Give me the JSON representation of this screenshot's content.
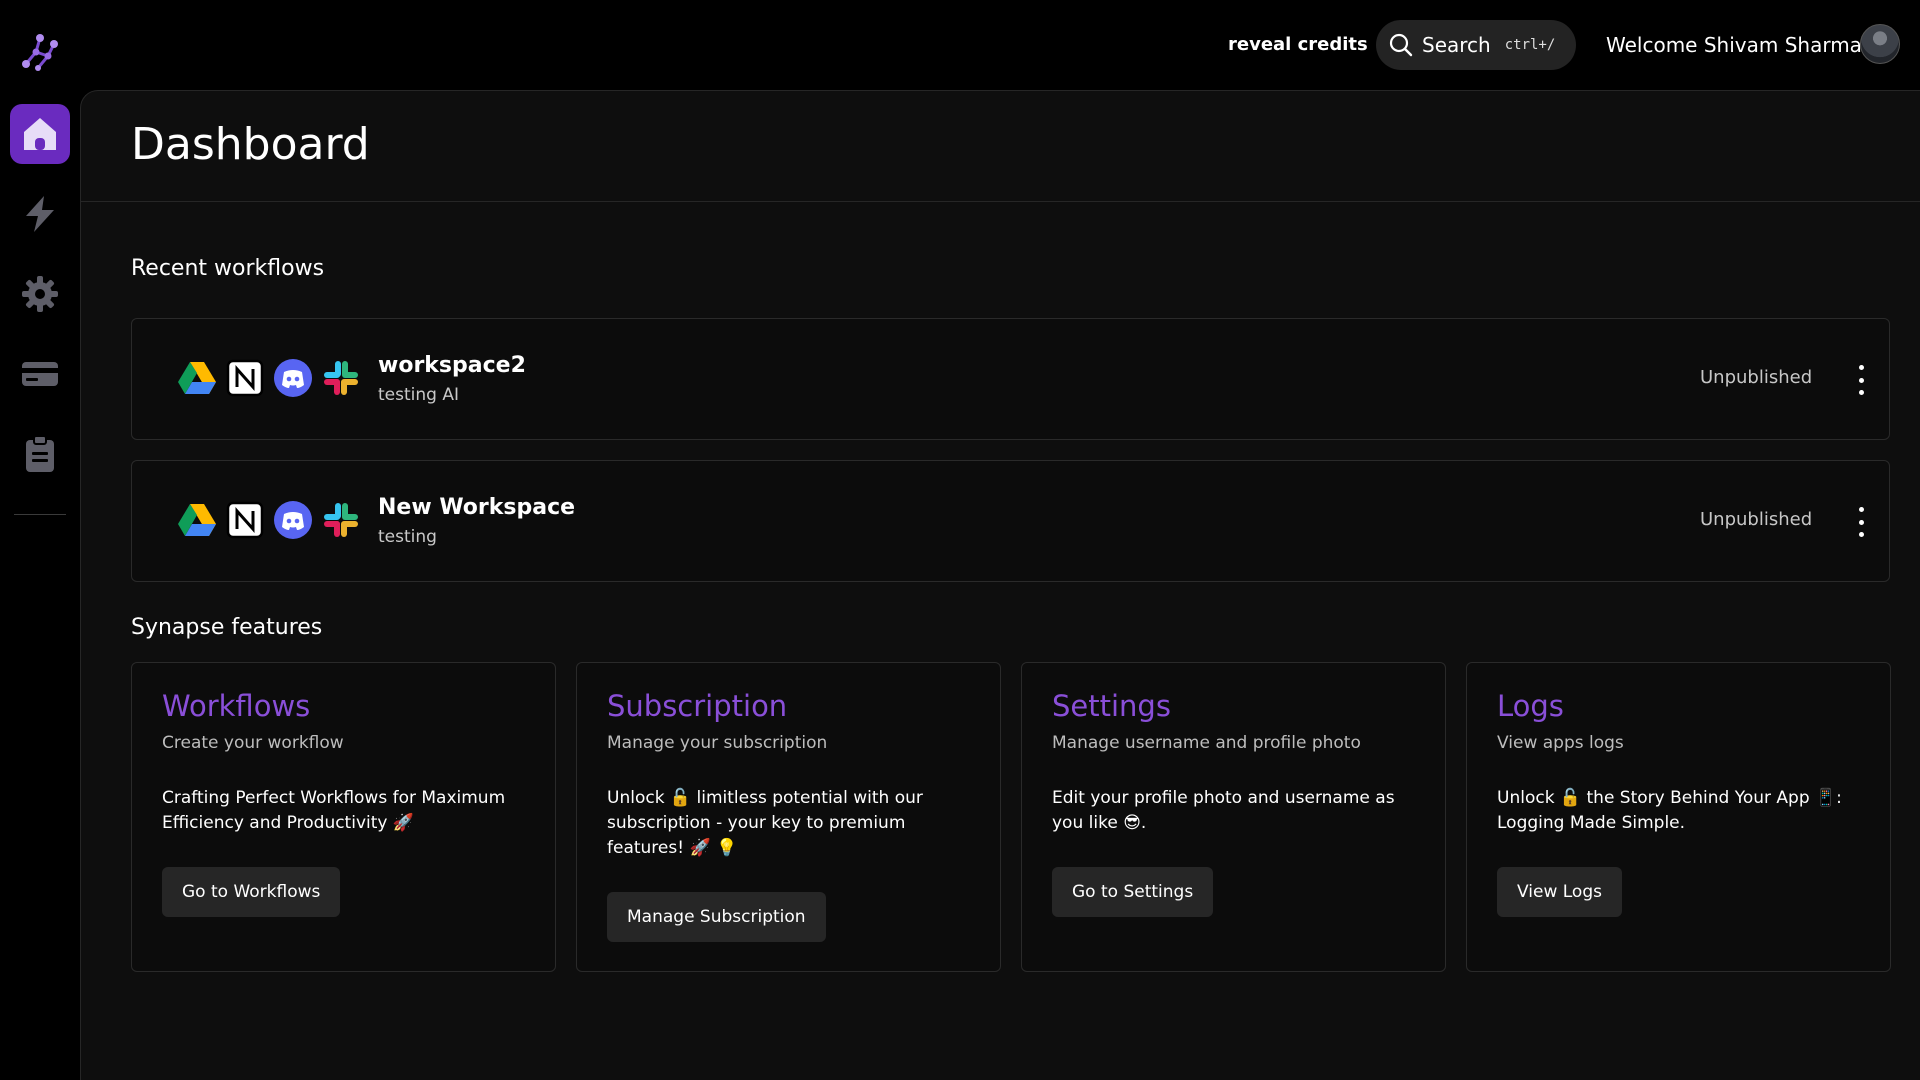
{
  "header": {
    "reveal_credits": "reveal credits",
    "search_label": "Search",
    "search_shortcut": "ctrl+/",
    "welcome": "Welcome Shivam Sharma"
  },
  "sidebar": {
    "items": [
      {
        "name": "home",
        "active": true
      },
      {
        "name": "workflows"
      },
      {
        "name": "settings"
      },
      {
        "name": "subscription"
      },
      {
        "name": "logs"
      }
    ]
  },
  "page": {
    "title": "Dashboard",
    "recent_title": "Recent workflows",
    "features_title": "Synapse features"
  },
  "workflows": [
    {
      "name": "workspace2",
      "description": "testing AI",
      "status": "Unpublished",
      "apps": [
        "google-drive-icon",
        "notion-icon",
        "discord-icon",
        "slack-icon"
      ]
    },
    {
      "name": "New Workspace",
      "description": "testing",
      "status": "Unpublished",
      "apps": [
        "google-drive-icon",
        "notion-icon",
        "discord-icon",
        "slack-icon"
      ]
    }
  ],
  "features": [
    {
      "title": "Workflows",
      "subtitle": "Create your workflow",
      "body": "Crafting Perfect Workflows for Maximum Efficiency and Productivity 🚀",
      "button": "Go to Workflows"
    },
    {
      "title": "Subscription",
      "subtitle": "Manage your subscription",
      "body": "Unlock 🔓 limitless potential with our subscription - your key to premium features! 🚀 💡",
      "button": "Manage Subscription"
    },
    {
      "title": "Settings",
      "subtitle": "Manage username and profile photo",
      "body": "Edit your profile photo and username as you like 😎.",
      "button": "Go to Settings"
    },
    {
      "title": "Logs",
      "subtitle": "View apps logs",
      "body": "Unlock 🔓 the Story Behind Your App 📱: Logging Made Simple.",
      "button": "View Logs"
    }
  ],
  "colors": {
    "accent": "#6a2bbf",
    "feature_title": "#8a4fd8",
    "background": "#000000",
    "panel": "#0e0e0e"
  }
}
